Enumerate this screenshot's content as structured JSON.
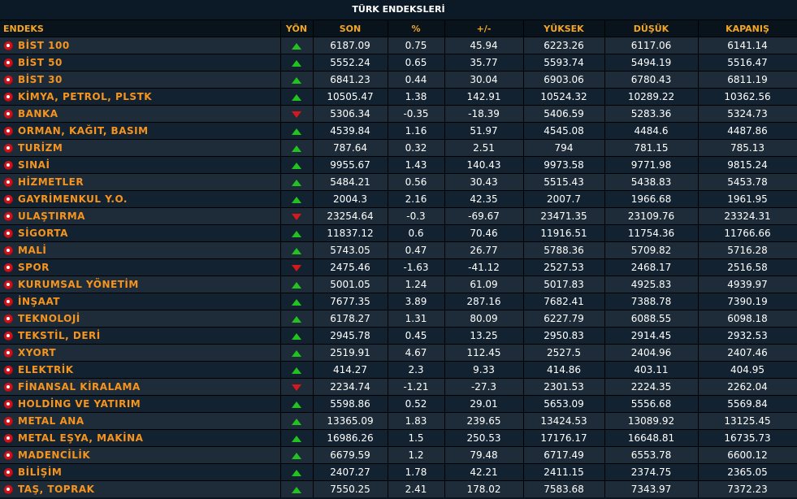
{
  "title": "TÜRK ENDEKSLERİ",
  "colors": {
    "accent": "#f7941d",
    "up": "#22c21f",
    "down": "#d6171b",
    "background": "#09151f"
  },
  "columns": {
    "name": "ENDEKS",
    "direction": "YÖN",
    "last": "SON",
    "pct": "%",
    "change": "+/-",
    "high": "YÜKSEK",
    "low": "DÜŞÜK",
    "close": "KAPANIŞ"
  },
  "rows": [
    {
      "name": "BİST 100",
      "dir": "up",
      "last": "6187.09",
      "pct": "0.75",
      "change": "45.94",
      "high": "6223.26",
      "low": "6117.06",
      "close": "6141.14"
    },
    {
      "name": "BİST 50",
      "dir": "up",
      "last": "5552.24",
      "pct": "0.65",
      "change": "35.77",
      "high": "5593.74",
      "low": "5494.19",
      "close": "5516.47"
    },
    {
      "name": "BİST 30",
      "dir": "up",
      "last": "6841.23",
      "pct": "0.44",
      "change": "30.04",
      "high": "6903.06",
      "low": "6780.43",
      "close": "6811.19"
    },
    {
      "name": "KİMYA, PETROL, PLSTK",
      "dir": "up",
      "last": "10505.47",
      "pct": "1.38",
      "change": "142.91",
      "high": "10524.32",
      "low": "10289.22",
      "close": "10362.56"
    },
    {
      "name": "BANKA",
      "dir": "down",
      "last": "5306.34",
      "pct": "-0.35",
      "change": "-18.39",
      "high": "5406.59",
      "low": "5283.36",
      "close": "5324.73"
    },
    {
      "name": "ORMAN, KAĞIT, BASIM",
      "dir": "up",
      "last": "4539.84",
      "pct": "1.16",
      "change": "51.97",
      "high": "4545.08",
      "low": "4484.6",
      "close": "4487.86"
    },
    {
      "name": "TURİZM",
      "dir": "up",
      "last": "787.64",
      "pct": "0.32",
      "change": "2.51",
      "high": "794",
      "low": "781.15",
      "close": "785.13"
    },
    {
      "name": "SINAİ",
      "dir": "up",
      "last": "9955.67",
      "pct": "1.43",
      "change": "140.43",
      "high": "9973.58",
      "low": "9771.98",
      "close": "9815.24"
    },
    {
      "name": "HİZMETLER",
      "dir": "up",
      "last": "5484.21",
      "pct": "0.56",
      "change": "30.43",
      "high": "5515.43",
      "low": "5438.83",
      "close": "5453.78"
    },
    {
      "name": "GAYRİMENKUL Y.O.",
      "dir": "up",
      "last": "2004.3",
      "pct": "2.16",
      "change": "42.35",
      "high": "2007.7",
      "low": "1966.68",
      "close": "1961.95"
    },
    {
      "name": "ULAŞTIRMA",
      "dir": "down",
      "last": "23254.64",
      "pct": "-0.3",
      "change": "-69.67",
      "high": "23471.35",
      "low": "23109.76",
      "close": "23324.31"
    },
    {
      "name": "SİGORTA",
      "dir": "up",
      "last": "11837.12",
      "pct": "0.6",
      "change": "70.46",
      "high": "11916.51",
      "low": "11754.36",
      "close": "11766.66"
    },
    {
      "name": "MALİ",
      "dir": "up",
      "last": "5743.05",
      "pct": "0.47",
      "change": "26.77",
      "high": "5788.36",
      "low": "5709.82",
      "close": "5716.28"
    },
    {
      "name": "SPOR",
      "dir": "down",
      "last": "2475.46",
      "pct": "-1.63",
      "change": "-41.12",
      "high": "2527.53",
      "low": "2468.17",
      "close": "2516.58"
    },
    {
      "name": "KURUMSAL YÖNETİM",
      "dir": "up",
      "last": "5001.05",
      "pct": "1.24",
      "change": "61.09",
      "high": "5017.83",
      "low": "4925.83",
      "close": "4939.97"
    },
    {
      "name": "İNŞAAT",
      "dir": "up",
      "last": "7677.35",
      "pct": "3.89",
      "change": "287.16",
      "high": "7682.41",
      "low": "7388.78",
      "close": "7390.19"
    },
    {
      "name": "TEKNOLOJİ",
      "dir": "up",
      "last": "6178.27",
      "pct": "1.31",
      "change": "80.09",
      "high": "6227.79",
      "low": "6088.55",
      "close": "6098.18"
    },
    {
      "name": "TEKSTİL, DERİ",
      "dir": "up",
      "last": "2945.78",
      "pct": "0.45",
      "change": "13.25",
      "high": "2950.83",
      "low": "2914.45",
      "close": "2932.53"
    },
    {
      "name": "XYORT",
      "dir": "up",
      "last": "2519.91",
      "pct": "4.67",
      "change": "112.45",
      "high": "2527.5",
      "low": "2404.96",
      "close": "2407.46"
    },
    {
      "name": "ELEKTRİK",
      "dir": "up",
      "last": "414.27",
      "pct": "2.3",
      "change": "9.33",
      "high": "414.86",
      "low": "403.11",
      "close": "404.95"
    },
    {
      "name": "FİNANSAL KİRALAMA",
      "dir": "down",
      "last": "2234.74",
      "pct": "-1.21",
      "change": "-27.3",
      "high": "2301.53",
      "low": "2224.35",
      "close": "2262.04"
    },
    {
      "name": "HOLDİNG VE YATIRIM",
      "dir": "up",
      "last": "5598.86",
      "pct": "0.52",
      "change": "29.01",
      "high": "5653.09",
      "low": "5556.68",
      "close": "5569.84"
    },
    {
      "name": "METAL ANA",
      "dir": "up",
      "last": "13365.09",
      "pct": "1.83",
      "change": "239.65",
      "high": "13424.53",
      "low": "13089.92",
      "close": "13125.45"
    },
    {
      "name": "METAL EŞYA, MAKİNA",
      "dir": "up",
      "last": "16986.26",
      "pct": "1.5",
      "change": "250.53",
      "high": "17176.17",
      "low": "16648.81",
      "close": "16735.73"
    },
    {
      "name": "MADENCİLİK",
      "dir": "up",
      "last": "6679.59",
      "pct": "1.2",
      "change": "79.48",
      "high": "6717.49",
      "low": "6553.78",
      "close": "6600.12"
    },
    {
      "name": "BİLİŞİM",
      "dir": "up",
      "last": "2407.27",
      "pct": "1.78",
      "change": "42.21",
      "high": "2411.15",
      "low": "2374.75",
      "close": "2365.05"
    },
    {
      "name": "TAŞ, TOPRAK",
      "dir": "up",
      "last": "7550.25",
      "pct": "2.41",
      "change": "178.02",
      "high": "7583.68",
      "low": "7343.97",
      "close": "7372.23"
    }
  ]
}
